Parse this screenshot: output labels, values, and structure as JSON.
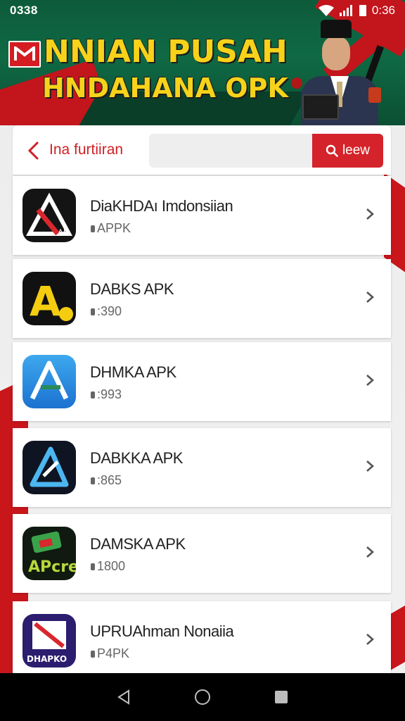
{
  "status_bar": {
    "time_left": "0338",
    "time_right": "0:36"
  },
  "banner": {
    "headline_line1": "NNIAN PUSAH",
    "headline_line2": "HNDAHANA OPK"
  },
  "search": {
    "title": "Ina furtiiran",
    "input_value": "",
    "button_label": "leew"
  },
  "apps": [
    {
      "name": "DiaKHDAı Imdonsiian",
      "sub": "APPK",
      "icon": "ak-black-icon"
    },
    {
      "name": "DABKS APK",
      "sub": ":390",
      "icon": "a-yellow-icon"
    },
    {
      "name": "DHMKA APK",
      "sub": ":993",
      "icon": "a-blue-icon"
    },
    {
      "name": "DABKKA APK",
      "sub": ":865",
      "icon": "a-dark-blue-icon"
    },
    {
      "name": "DAMSKA APK",
      "sub": "1800",
      "icon": "apk-green-icon"
    },
    {
      "name": "UPRUAhman Nonaiia",
      "sub": "P4PK",
      "icon": "dhapk-purple-icon"
    }
  ],
  "app_icon_texts": {
    "ak_black": "AK",
    "a_yellow": "A",
    "apk_green": "APcre",
    "dhapk": "DHAPKO"
  },
  "colors": {
    "accent_red": "#d4232a",
    "banner_green": "#0f6a44",
    "headline_yellow": "#f7d21b"
  }
}
